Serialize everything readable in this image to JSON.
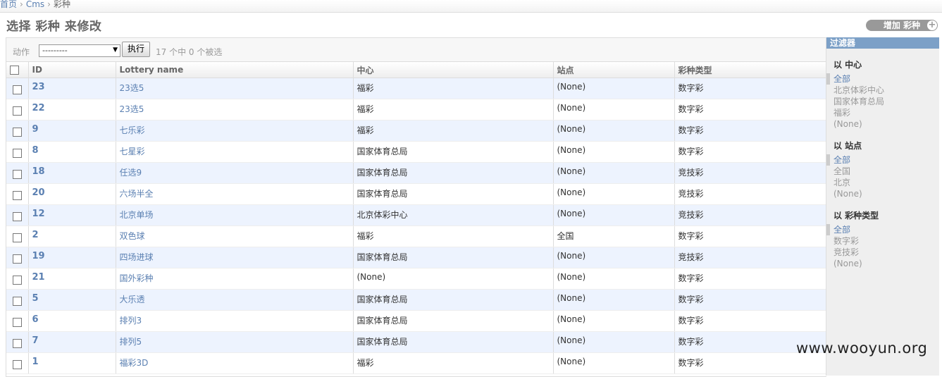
{
  "breadcrumbs": {
    "home": "首页",
    "app": "Cms",
    "current": "彩种"
  },
  "page_title": "选择 彩种 来修改",
  "add_button": {
    "label": "增加 彩种",
    "icon": "plus-icon"
  },
  "actions": {
    "label": "动作",
    "select_value": "---------",
    "go_label": "执行",
    "counter": "17 个中 0 个被选"
  },
  "columns": [
    "ID",
    "Lottery name",
    "中心",
    "站点",
    "彩种类型"
  ],
  "rows": [
    {
      "id": "23",
      "name": "23选5",
      "center": "福彩",
      "site": "(None)",
      "type": "数字彩"
    },
    {
      "id": "22",
      "name": "23选5",
      "center": "福彩",
      "site": "(None)",
      "type": "数字彩"
    },
    {
      "id": "9",
      "name": "七乐彩",
      "center": "福彩",
      "site": "(None)",
      "type": "数字彩"
    },
    {
      "id": "8",
      "name": "七星彩",
      "center": "国家体育总局",
      "site": "(None)",
      "type": "数字彩"
    },
    {
      "id": "18",
      "name": "任选9",
      "center": "国家体育总局",
      "site": "(None)",
      "type": "竞技彩"
    },
    {
      "id": "20",
      "name": "六场半全",
      "center": "国家体育总局",
      "site": "(None)",
      "type": "竞技彩"
    },
    {
      "id": "12",
      "name": "北京单场",
      "center": "北京体彩中心",
      "site": "(None)",
      "type": "竞技彩"
    },
    {
      "id": "2",
      "name": "双色球",
      "center": "福彩",
      "site": "全国",
      "type": "数字彩"
    },
    {
      "id": "19",
      "name": "四场进球",
      "center": "国家体育总局",
      "site": "(None)",
      "type": "竞技彩"
    },
    {
      "id": "21",
      "name": "国外彩种",
      "center": "(None)",
      "site": "(None)",
      "type": "数字彩"
    },
    {
      "id": "5",
      "name": "大乐透",
      "center": "国家体育总局",
      "site": "(None)",
      "type": "数字彩"
    },
    {
      "id": "6",
      "name": "排列3",
      "center": "国家体育总局",
      "site": "(None)",
      "type": "数字彩"
    },
    {
      "id": "7",
      "name": "排列5",
      "center": "国家体育总局",
      "site": "(None)",
      "type": "数字彩"
    },
    {
      "id": "1",
      "name": "福彩3D",
      "center": "福彩",
      "site": "(None)",
      "type": "数字彩"
    }
  ],
  "filter": {
    "title": "过滤器",
    "groups": [
      {
        "heading": "以 中心",
        "items": [
          "全部",
          "北京体彩中心",
          "国家体育总局",
          "福彩",
          "(None)"
        ]
      },
      {
        "heading": "以 站点",
        "items": [
          "全部",
          "全国",
          "北京",
          "(None)"
        ]
      },
      {
        "heading": "以 彩种类型",
        "items": [
          "全部",
          "数字彩",
          "竞技彩",
          "(None)"
        ]
      }
    ]
  },
  "watermark": "www.wooyun.org"
}
